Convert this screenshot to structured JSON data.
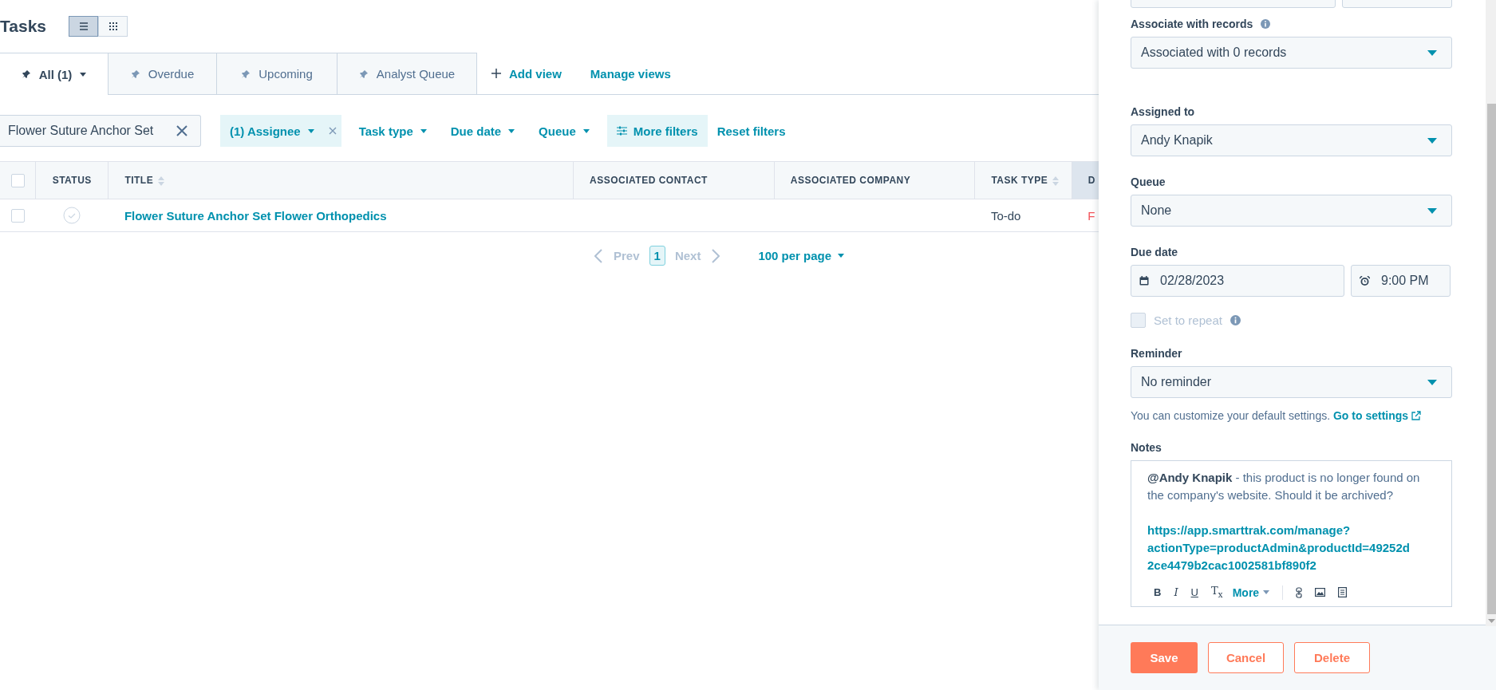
{
  "page": {
    "title": "Tasks",
    "view_toggle": [
      {
        "kind": "list",
        "selected": true
      },
      {
        "kind": "grid",
        "selected": false
      }
    ]
  },
  "view_tabs": [
    {
      "label": "All (1)",
      "selected": true,
      "dropdown": true
    },
    {
      "label": "Overdue",
      "selected": false,
      "dropdown": false
    },
    {
      "label": "Upcoming",
      "selected": false,
      "dropdown": false
    },
    {
      "label": "Analyst Queue",
      "selected": false,
      "dropdown": false
    }
  ],
  "view_actions": [
    {
      "kind": "add",
      "label": "Add view"
    },
    {
      "kind": "manage",
      "label": "Manage views"
    }
  ],
  "filters": {
    "search": {
      "value": "Flower Suture Anchor Set"
    },
    "chips": [
      {
        "kind": "applied",
        "label": "(1) Assignee"
      },
      {
        "kind": "dropdown",
        "label": "Task type"
      },
      {
        "kind": "dropdown",
        "label": "Due date"
      },
      {
        "kind": "dropdown",
        "label": "Queue"
      },
      {
        "kind": "more",
        "label": "More filters"
      },
      {
        "kind": "reset",
        "label": "Reset filters"
      }
    ]
  },
  "table": {
    "select_all_checked": false,
    "columns": [
      {
        "label": "STATUS",
        "sortable": false,
        "sorted": false
      },
      {
        "label": "TITLE",
        "sortable": true,
        "sorted": false
      },
      {
        "label": "ASSOCIATED CONTACT",
        "sortable": false,
        "sorted": false
      },
      {
        "label": "ASSOCIATED COMPANY",
        "sortable": false,
        "sorted": false
      },
      {
        "label": "TASK TYPE",
        "sortable": true,
        "sorted": false
      },
      {
        "label": "D",
        "sorted": true
      }
    ],
    "rows": [
      {
        "checked": false,
        "completed": false,
        "title": "Flower Suture Anchor Set Flower Orthopedics",
        "task_type": "To-do",
        "column_6": "F",
        "overdue": true
      }
    ]
  },
  "pagination": {
    "prev": "Prev",
    "page": "1",
    "next": "Next",
    "per_page": "100 per page",
    "prev_disabled": true,
    "next_disabled": true
  },
  "task_panel": {
    "associate": {
      "label": "Associate with records",
      "value": "Associated with 0 records"
    },
    "assigned_to": {
      "label": "Assigned to",
      "value": "Andy Knapik"
    },
    "queue": {
      "label": "Queue",
      "value": "None"
    },
    "due_date": {
      "label": "Due date",
      "date": "02/28/2023",
      "time": "9:00 PM"
    },
    "repeat": {
      "label": "Set to repeat",
      "checked": false,
      "disabled": true
    },
    "reminder": {
      "label": "Reminder",
      "value": "No reminder",
      "help": "You can customize your default settings.",
      "help_link": "Go to settings"
    },
    "notes": {
      "label": "Notes",
      "text": "**@Andy Knapik** - this product is no longer found on the company's website. Should it be archived?",
      "link": "https://app.smarttrak.com/manage?actionType=productAdmin&productId=49252d2ce4479b2cac1002581bf890f2",
      "format_buttons": [
        {
          "kind": "bold",
          "label": "B"
        },
        {
          "kind": "italic",
          "label": "I"
        },
        {
          "kind": "underline",
          "label": "U"
        },
        {
          "kind": "clear",
          "label": "T$_{x}$"
        }
      ],
      "more": "More"
    },
    "buttons": [
      {
        "kind": "primary",
        "label": "Save"
      },
      {
        "kind": "secondary",
        "label": "Cancel"
      },
      {
        "kind": "secondary",
        "label": "Delete"
      }
    ]
  }
}
